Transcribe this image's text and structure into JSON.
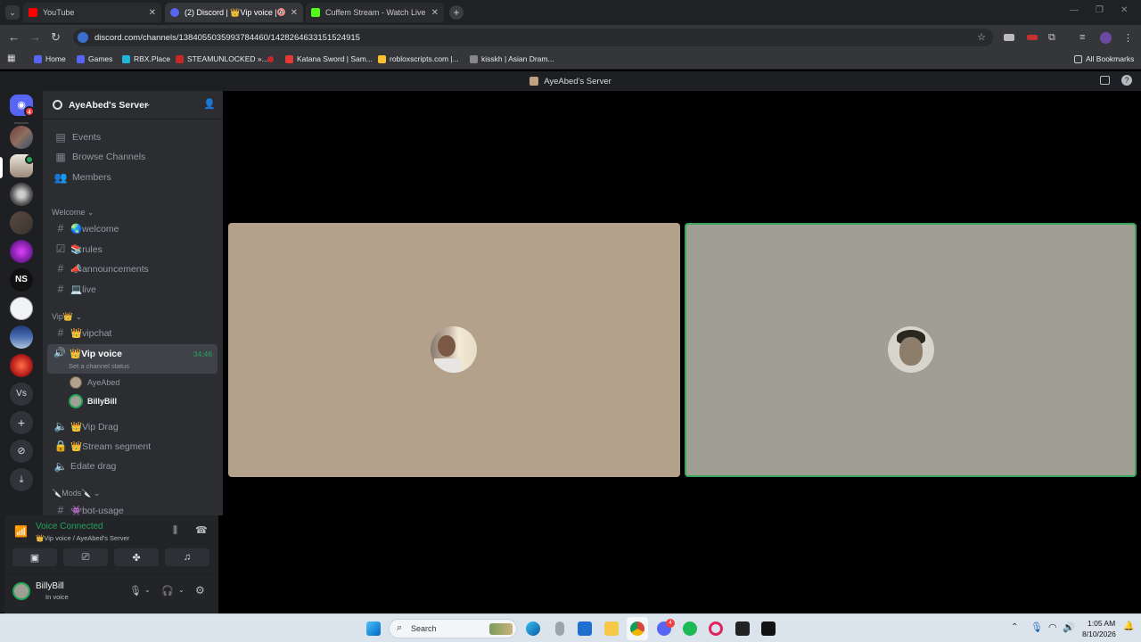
{
  "browser": {
    "tabs": [
      {
        "label": "YouTube"
      },
      {
        "label": "(2) Discord | 👑Vip voice | A"
      },
      {
        "label": "Cuffem Stream - Watch Live on"
      }
    ],
    "url": "discord.com/channels/1384055035993784460/1428264633151524915",
    "bookmarks": [
      {
        "label": "Home"
      },
      {
        "label": "Games"
      },
      {
        "label": "RBX.Place"
      },
      {
        "label": "STEAMUNLOCKED »..."
      },
      {
        "label": "Katana Sword | Sam..."
      },
      {
        "label": "robloxscripts.com |..."
      },
      {
        "label": "kisskh | Asian Dram..."
      }
    ],
    "all_bookmarks": "All Bookmarks"
  },
  "discord": {
    "window_title": "AyeAbed's Server",
    "rail_badge": "4",
    "server_name": "AyeAbed's Server",
    "top_items": [
      {
        "label": "Events"
      },
      {
        "label": "Browse Channels"
      },
      {
        "label": "Members"
      }
    ],
    "categories": {
      "welcome": "Welcome",
      "vip": "Vip👑",
      "mods": "🔪Mods🔪"
    },
    "welcome_channels": [
      {
        "label": "🌏welcome"
      },
      {
        "label": "📚rules"
      },
      {
        "label": "📣announcements"
      },
      {
        "label": "💻live"
      }
    ],
    "vip_channels": {
      "vipchat": "👑vipchat",
      "vip_voice": "👑Vip voice",
      "vip_voice_timer": "34:46",
      "channel_status": "Set a channel status",
      "members": [
        {
          "name": "AyeAbed"
        },
        {
          "name": "BillyBill"
        }
      ],
      "vip_drag": "👑Vip Drag",
      "stream_segment": "👑Stream segment",
      "edate_drag": "Edate drag"
    },
    "mods_channels": {
      "bot_usage": "👾bot-usage"
    },
    "voice": {
      "status": "Voice Connected",
      "channel": "👑Vip voice / AyeAbed's Server"
    },
    "user": {
      "name": "BillyBill",
      "status": "In voice"
    }
  },
  "taskbar": {
    "search": "Search",
    "time": "1:05 AM",
    "date": "8/10/2026",
    "discord_badge": "4"
  },
  "colors": {
    "tile_left": "#b4a18c",
    "tile_right": "#a09f93",
    "speaking_border": "#3ba55d"
  }
}
